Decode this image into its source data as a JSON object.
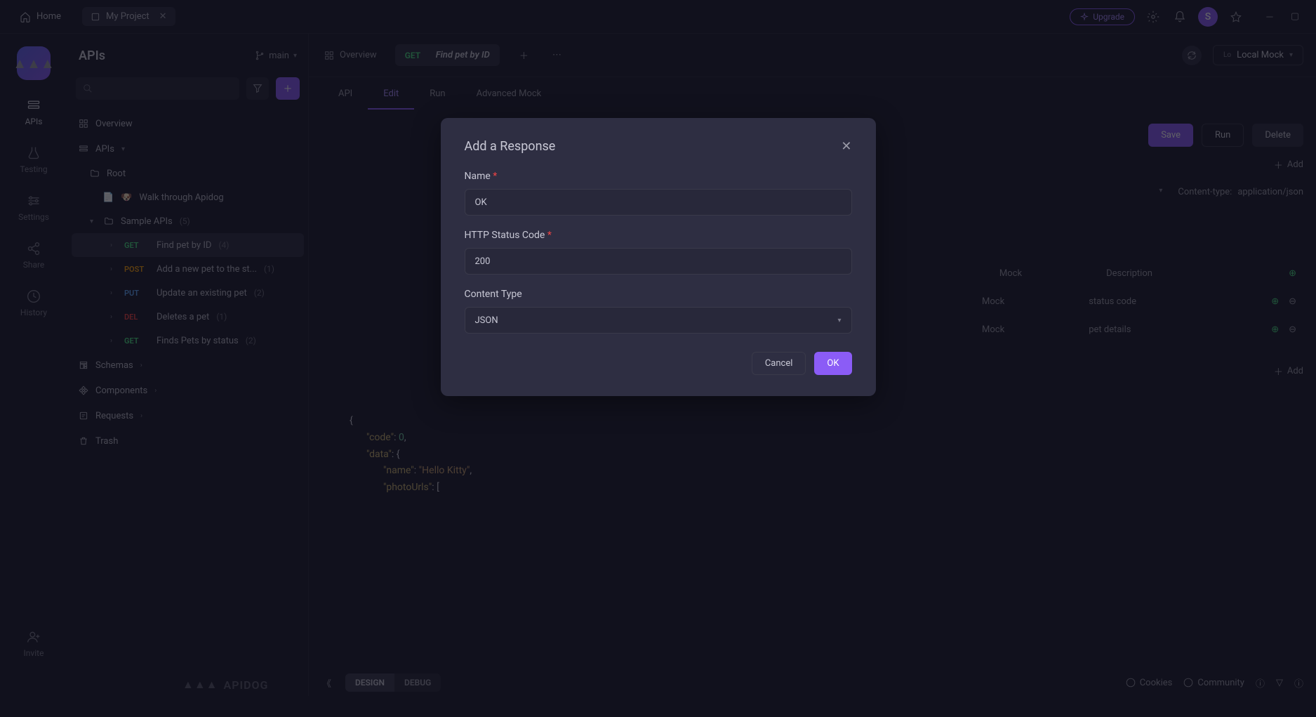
{
  "titlebar": {
    "home": "Home",
    "tab": "My Project",
    "upgrade": "Upgrade",
    "avatar_initial": "S"
  },
  "rail": {
    "items": [
      {
        "label": "APIs"
      },
      {
        "label": "Testing"
      },
      {
        "label": "Settings"
      },
      {
        "label": "Share"
      },
      {
        "label": "History"
      },
      {
        "label": "Invite"
      }
    ]
  },
  "sidebar": {
    "title": "APIs",
    "branch": "main",
    "overview": "Overview",
    "apis_section": "APIs",
    "root": "Root",
    "walkthrough": "Walk through Apidog",
    "sample_apis": "Sample APIs",
    "sample_count": "(5)",
    "endpoints": [
      {
        "method": "GET",
        "label": "Find pet by ID",
        "count": "(4)"
      },
      {
        "method": "POST",
        "label": "Add a new pet to the st...",
        "count": "(1)"
      },
      {
        "method": "PUT",
        "label": "Update an existing pet",
        "count": "(2)"
      },
      {
        "method": "DEL",
        "label": "Deletes a pet",
        "count": "(1)"
      },
      {
        "method": "GET",
        "label": "Finds Pets by status",
        "count": "(2)"
      }
    ],
    "schemas": "Schemas",
    "components": "Components",
    "requests": "Requests",
    "trash": "Trash"
  },
  "tabs": {
    "overview": "Overview",
    "active_method": "GET",
    "active_title": "Find pet by ID"
  },
  "env": {
    "prefix": "Lo",
    "value": "Local Mock"
  },
  "sub_tabs": {
    "api": "API",
    "edit": "Edit",
    "run": "Run",
    "advanced_mock": "Advanced Mock"
  },
  "actions": {
    "save": "Save",
    "run": "Run",
    "delete": "Delete",
    "add": "Add"
  },
  "meta": {
    "content_type_label": "Content-type:",
    "content_type": "application/json"
  },
  "table": {
    "rows": [
      {
        "mock": "Mock",
        "desc": "Description"
      },
      {
        "mock": "Mock",
        "desc": "status code"
      },
      {
        "mock": "Mock",
        "desc": "pet details"
      }
    ]
  },
  "code": {
    "l1": "{",
    "l2": "\"code\": 0,",
    "l3": "\"data\": {",
    "l4": "\"name\": \"Hello Kitty\",",
    "l5": "\"photoUrls\": ["
  },
  "mode_tabs": {
    "design": "DESIGN",
    "debug": "DEBUG"
  },
  "footer": {
    "cookies": "Cookies",
    "community": "Community"
  },
  "brand": "APIDOG",
  "modal": {
    "title": "Add a Response",
    "name_label": "Name",
    "name_value": "OK",
    "code_label": "HTTP Status Code",
    "code_value": "200",
    "type_label": "Content Type",
    "type_value": "JSON",
    "cancel": "Cancel",
    "ok": "OK"
  }
}
